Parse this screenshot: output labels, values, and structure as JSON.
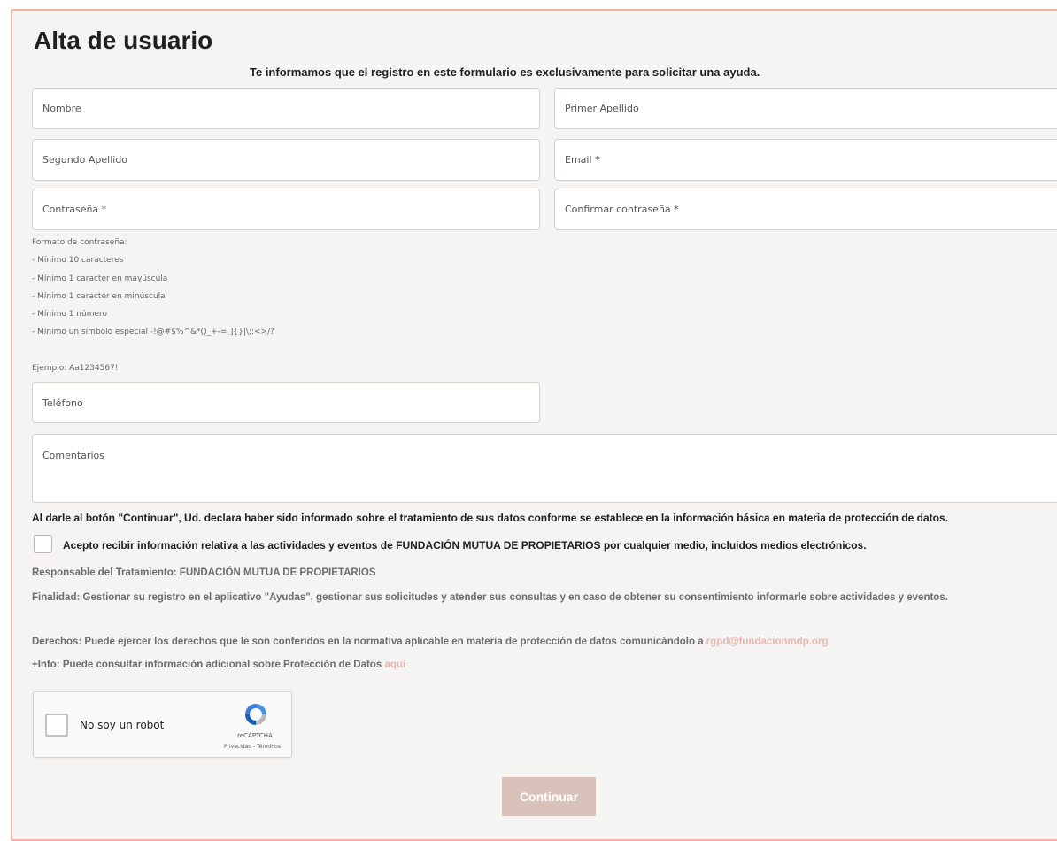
{
  "form": {
    "title": "Alta de usuario",
    "subtitle": "Te informamos que el registro en este formulario es exclusivamente para solicitar una ayuda.",
    "fields": {
      "nombre": "Nombre",
      "primer_apellido": "Primer Apellido",
      "segundo_apellido": "Segundo Apellido",
      "email": "Email *",
      "contrasena": "Contraseña *",
      "confirmar_contrasena": "Confirmar contraseña *",
      "telefono": "Teléfono",
      "comentarios": "Comentarios"
    },
    "password_hint": {
      "heading": "Formato de contraseña:",
      "rules": [
        "- Mínimo 10 caracteres",
        "- Mínimo 1 caracter en mayúscula",
        "- Mínimo 1 caracter en minúscula",
        "- Mínimo 1 número",
        "- Mínimo un símbolo especial -!@#$%^&*()_+-=[]{}|\\;:<>/?"
      ],
      "example": "Ejemplo: Aa1234567!"
    },
    "declaration": "Al darle al botón \"Continuar\", Ud. declara haber sido informado sobre el tratamiento de sus datos conforme se establece en la información básica en materia de protección de datos.",
    "consent_label": "Acepto recibir información relativa a las actividades y eventos de FUNDACIÓN MUTUA DE PROPIETARIOS por cualquier medio, incluidos medios electrónicos.",
    "privacy": {
      "responsable": "Responsable del Tratamiento: FUNDACIÓN MUTUA DE PROPIETARIOS",
      "finalidad": "Finalidad: Gestionar su registro en el aplicativo \"Ayudas\", gestionar sus solicitudes y atender sus consultas y en caso de obtener su consentimiento informarle sobre actividades y eventos.",
      "derechos": "Derechos: Puede ejercer los derechos que le son conferidos en la normativa aplicable en materia de protección de datos comunicándolo a",
      "derechos_email": "rgpd@fundacionmdp.org",
      "info": "+Info: Puede consultar información adicional sobre Protección de Datos",
      "info_link": "aquí"
    },
    "recaptcha": {
      "label": "No soy un robot",
      "brand": "reCAPTCHA",
      "links": "Privacidad - Términos"
    },
    "submit_label": "Continuar"
  },
  "colors": {
    "frame_border": "#efb4a8",
    "page_bg": "#f6f4f2",
    "button_bg": "#d9c2ba",
    "link": "#e4b8b0"
  }
}
